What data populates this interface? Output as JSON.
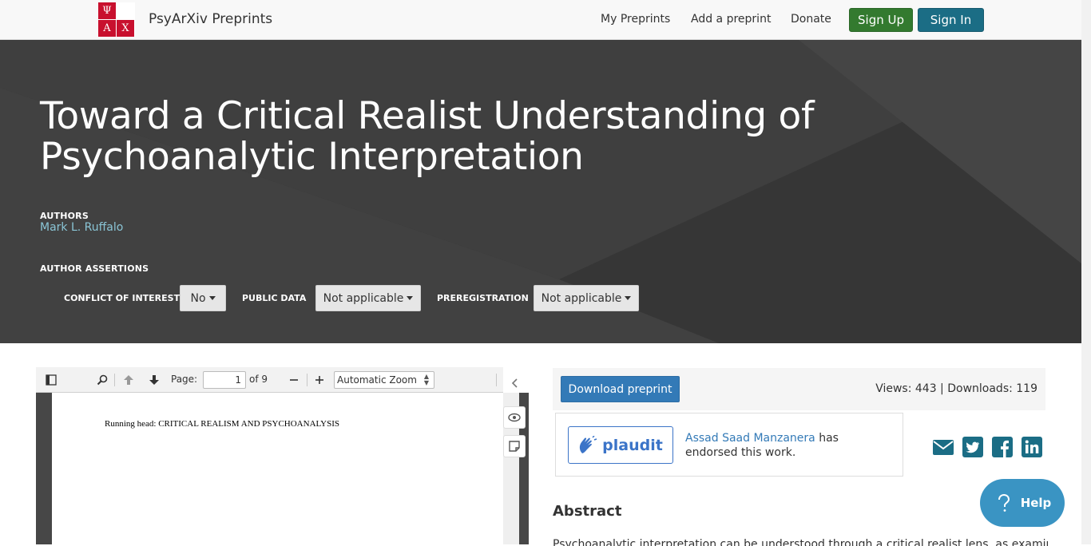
{
  "navbar": {
    "logo_letters": [
      "Ψ",
      "",
      "Α",
      "Χ"
    ],
    "brand": "PsyArXiv Preprints",
    "links": [
      "My Preprints",
      "Add a preprint",
      "Donate"
    ],
    "signup": "Sign Up",
    "signin": "Sign In"
  },
  "header": {
    "title": "Toward a Critical Realist Understanding of Psychoanalytic Interpretation",
    "authors_label": "AUTHORS",
    "author": "Mark L. Ruffalo",
    "assertions_label": "AUTHOR ASSERTIONS",
    "assertions": [
      {
        "label": "CONFLICT OF INTEREST",
        "value": "No"
      },
      {
        "label": "PUBLIC DATA",
        "value": "Not applicable"
      },
      {
        "label": "PREREGISTRATION",
        "value": "Not applicable"
      }
    ]
  },
  "pdf": {
    "page_label": "Page:",
    "page_current": "1",
    "page_total": "of 9",
    "zoom": "Automatic Zoom",
    "running_head": "Running head: CRITICAL REALISM AND PSYCHOANALYSIS"
  },
  "sidebar": {
    "download": "Download preprint",
    "stats": "Views: 443 | Downloads: 119",
    "plaudit_logo": "plaudit",
    "endorser": "Assad Saad Manzanera",
    "endorse_suffix": " has endorsed this work.",
    "abstract_heading": "Abstract",
    "abstract_first_line": "Psychoanalytic interpretation can be understood through a critical realist lens, as examined here,"
  },
  "help": {
    "label": "Help"
  },
  "colors": {
    "signup": "#337a2f",
    "signin": "#1b6d85",
    "header_bg": "#3a3a3a",
    "link": "#337ab7"
  }
}
